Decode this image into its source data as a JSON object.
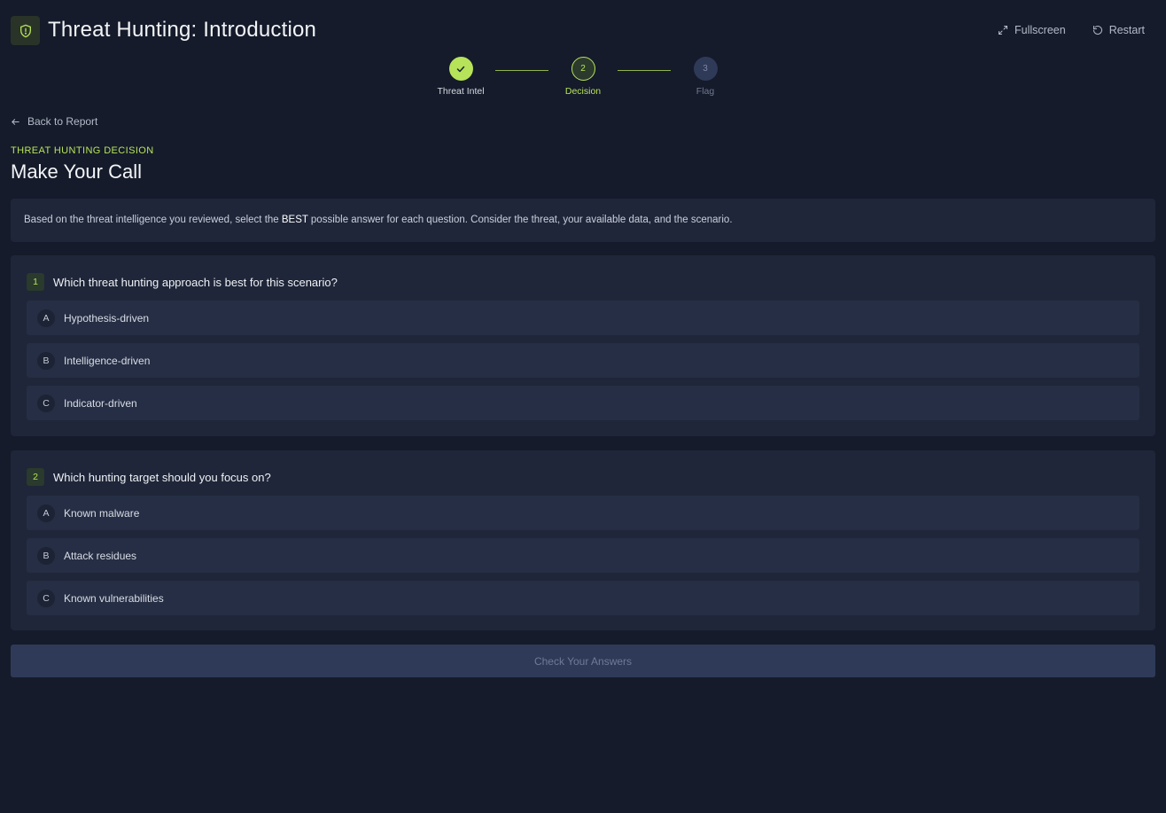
{
  "header": {
    "title": "Threat Hunting: Introduction",
    "fullscreen_label": "Fullscreen",
    "restart_label": "Restart",
    "logo_icon": "shield-alert-icon"
  },
  "stepper": {
    "steps": [
      {
        "number": "1",
        "label": "Threat Intel",
        "status": "done"
      },
      {
        "number": "2",
        "label": "Decision",
        "status": "active"
      },
      {
        "number": "3",
        "label": "Flag",
        "status": "todo"
      }
    ]
  },
  "nav": {
    "back_label": "Back to Report"
  },
  "section": {
    "kicker": "THREAT HUNTING DECISION",
    "title": "Make Your Call",
    "intro_before": "Based on the threat intelligence you reviewed, select the ",
    "intro_emphasis": "BEST",
    "intro_after": " possible answer for each question. Consider the threat, your available data, and the scenario."
  },
  "questions": [
    {
      "number": "1",
      "text": "Which threat hunting approach is best for this scenario?",
      "options": [
        {
          "letter": "A",
          "text": "Hypothesis-driven"
        },
        {
          "letter": "B",
          "text": "Intelligence-driven"
        },
        {
          "letter": "C",
          "text": "Indicator-driven"
        }
      ]
    },
    {
      "number": "2",
      "text": "Which hunting target should you focus on?",
      "options": [
        {
          "letter": "A",
          "text": "Known malware"
        },
        {
          "letter": "B",
          "text": "Attack residues"
        },
        {
          "letter": "C",
          "text": "Known vulnerabilities"
        }
      ]
    }
  ],
  "submit": {
    "label": "Check Your Answers"
  },
  "colors": {
    "accent": "#b6e35a",
    "background": "#151b2a",
    "card": "#1f2639",
    "option": "#252e44"
  }
}
